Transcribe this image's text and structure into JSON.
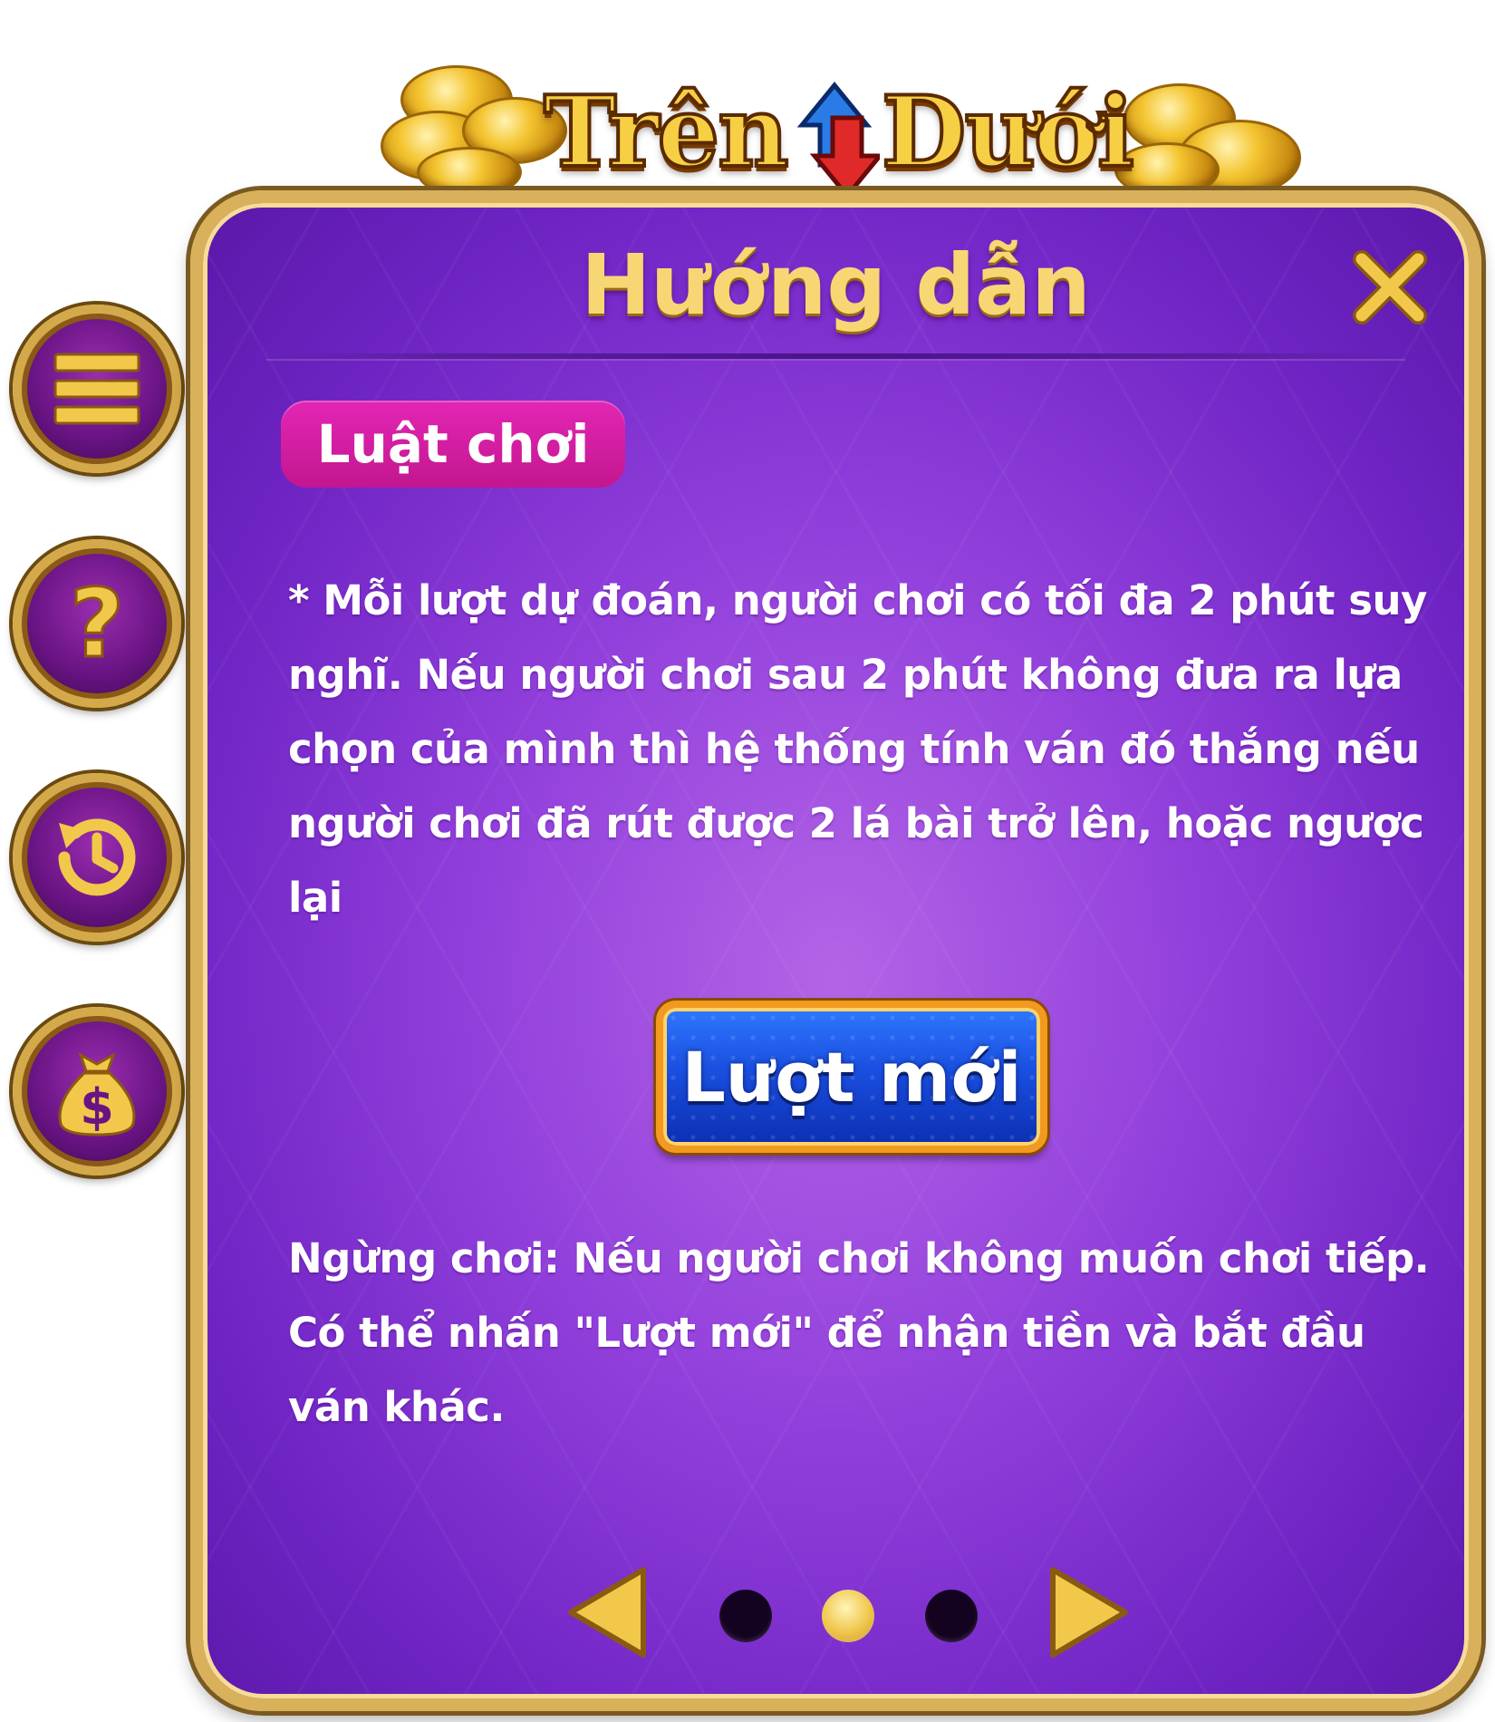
{
  "logo": {
    "title_left": "Trên",
    "title_right": "Dưới",
    "icon": "up-down-arrows-icon"
  },
  "side_menu": [
    {
      "name": "menu-button",
      "icon": "menu-icon"
    },
    {
      "name": "help-button",
      "icon": "question-icon"
    },
    {
      "name": "history-button",
      "icon": "history-icon"
    },
    {
      "name": "money-bag-button",
      "icon": "money-bag-icon"
    }
  ],
  "dialog": {
    "title": "Hướng dẫn",
    "close_icon": "close-icon",
    "section_label": "Luật chơi",
    "rule_1": "* Mỗi lượt dự đoán, người chơi có tối đa 2 phút suy nghĩ. Nếu người chơi sau 2 phút không đưa ra lựa chọn của mình thì hệ thống tính ván đó thắng nếu người chơi đã rút được 2 lá bài trở lên, hoặc ngược lại",
    "new_round_label": "Lượt mới",
    "rule_2": "Ngừng chơi: Nếu người chơi không muốn chơi tiếp. Có thể nhấn \"Lượt mới\" để nhận tiền và bắt đầu ván khác."
  },
  "pagination": {
    "prev_icon": "arrow-left-icon",
    "next_icon": "arrow-right-icon",
    "total_pages": 3,
    "current_page": 2
  },
  "colors": {
    "panel_purple": "#9240dc",
    "gold_border": "#d9b15b",
    "section_tag_pink": "#d11ea2",
    "button_blue": "#1a4fe0",
    "title_gold": "#f7d774"
  }
}
